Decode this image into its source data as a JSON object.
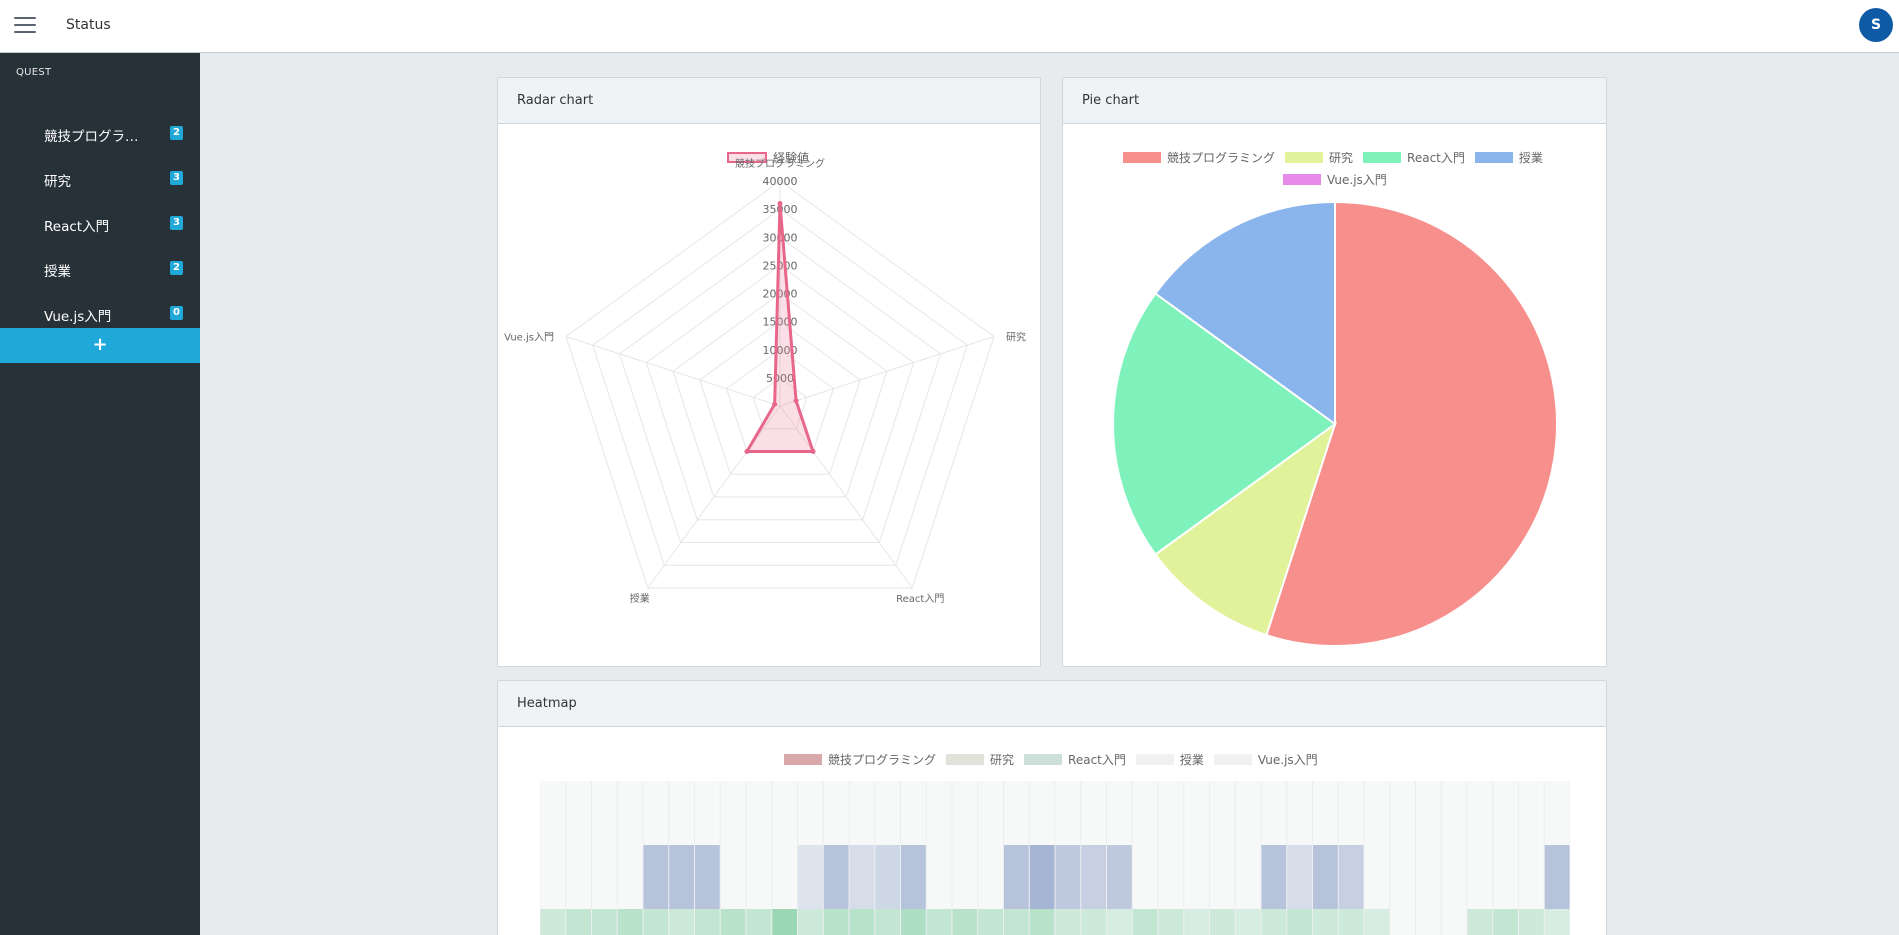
{
  "topbar": {
    "title": "Status",
    "avatar_initial": "S"
  },
  "sidebar": {
    "section": "QUEST",
    "items": [
      {
        "label": "競技プログラミング",
        "badge": "2"
      },
      {
        "label": "研究",
        "badge": "3"
      },
      {
        "label": "React入門",
        "badge": "3"
      },
      {
        "label": "授業",
        "badge": "2"
      },
      {
        "label": "Vue.js入門",
        "badge": "0"
      }
    ],
    "add_label": "+"
  },
  "colors": {
    "accent": "#20a8d8",
    "sidebar_bg": "#263238",
    "radar": "#e8668a",
    "pie": [
      "#f7908c",
      "#e1f29a",
      "#7ff2bc",
      "#8ab4ec",
      "#e58ae8"
    ]
  },
  "cards": {
    "radar": {
      "title": "Radar chart"
    },
    "pie": {
      "title": "Pie chart"
    },
    "heatmap": {
      "title": "Heatmap"
    }
  },
  "chart_data": [
    {
      "type": "radar",
      "title": "Radar chart",
      "labels": [
        "競技プログラミング",
        "研究",
        "React入門",
        "授業",
        "Vue.js入門"
      ],
      "series": [
        {
          "name": "経験値",
          "values": [
            36000,
            3000,
            10000,
            10000,
            1000
          ]
        }
      ],
      "ticks": [
        5000,
        10000,
        15000,
        20000,
        25000,
        30000,
        35000,
        40000
      ],
      "rmax": 40000,
      "legend": "top"
    },
    {
      "type": "pie",
      "title": "Pie chart",
      "labels": [
        "競技プログラミング",
        "研究",
        "React入門",
        "授業",
        "Vue.js入門"
      ],
      "values": [
        55,
        10,
        20,
        15,
        0
      ],
      "legend": "top"
    },
    {
      "type": "heatmap",
      "title": "Heatmap",
      "series": [
        {
          "name": "競技プログラミング",
          "color": "#d8a8ab"
        },
        {
          "name": "研究",
          "color": "#dfe3da"
        },
        {
          "name": "React入門",
          "color": "#cde0d7"
        },
        {
          "name": "授業",
          "color": "#f0f1f2"
        },
        {
          "name": "Vue.js入門",
          "color": "#f0f1f2"
        }
      ],
      "legend": "top",
      "rows": [
        {
          "name": "授業",
          "color": "#a5b5d3",
          "values": [
            0,
            0,
            0,
            0,
            0.8,
            0.8,
            0.8,
            0,
            0,
            0,
            0.3,
            0.8,
            0.4,
            0.5,
            0.8,
            0,
            0,
            0,
            0.8,
            1,
            0.7,
            0.6,
            0.7,
            0,
            0,
            0,
            0,
            0,
            0.8,
            0.4,
            0.8,
            0.6,
            0,
            0,
            0,
            0,
            0,
            0,
            0,
            0.8,
            0.8,
            0.7,
            0,
            0.8,
            0,
            0,
            0
          ]
        },
        {
          "name": "React入門",
          "color": "#8fd3ad",
          "values": [
            0.4,
            0.5,
            0.5,
            0.6,
            0.5,
            0.4,
            0.5,
            0.6,
            0.5,
            0.9,
            0.4,
            0.6,
            0.6,
            0.5,
            0.7,
            0.5,
            0.6,
            0.5,
            0.5,
            0.6,
            0.4,
            0.4,
            0.3,
            0.5,
            0.4,
            0.3,
            0.4,
            0.3,
            0.4,
            0.5,
            0.4,
            0.4,
            0.3,
            0,
            0,
            0,
            0.4,
            0.5,
            0.4,
            0.3,
            0.4,
            0.5,
            0,
            0,
            0,
            0,
            0
          ]
        }
      ]
    }
  ]
}
